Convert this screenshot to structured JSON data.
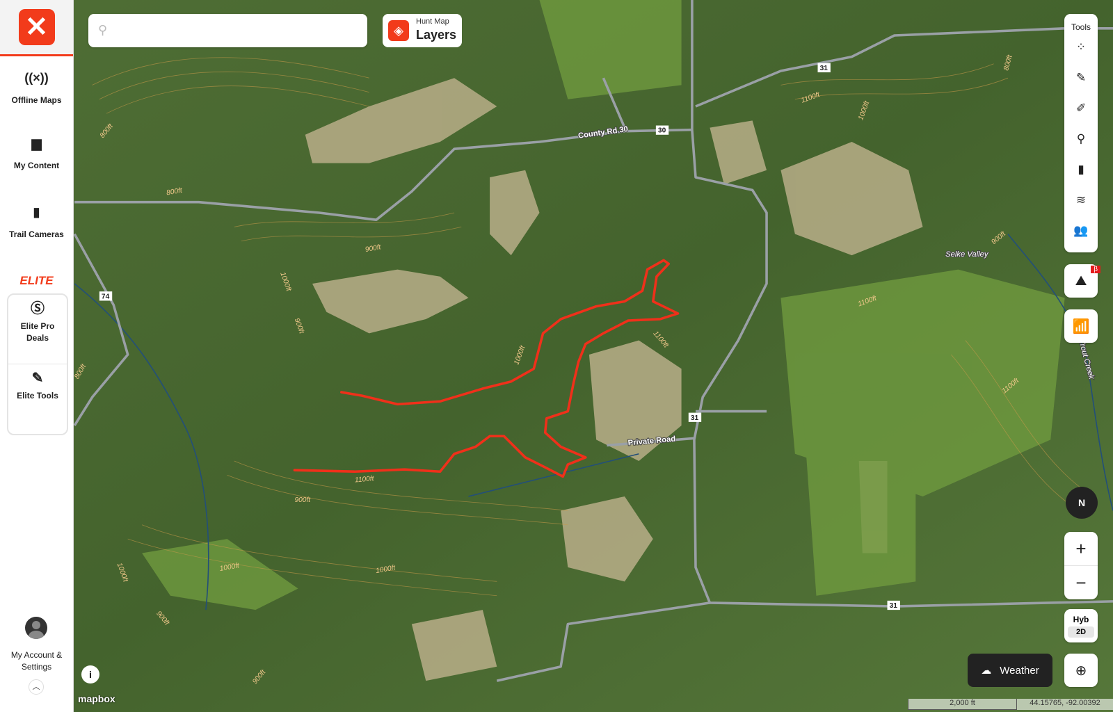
{
  "sidebar": {
    "items": [
      {
        "label": "Offline Maps",
        "icon": "offline-icon"
      },
      {
        "label": "My Content",
        "icon": "folder-icon"
      },
      {
        "label": "Trail Cameras",
        "icon": "trail-camera-icon"
      }
    ],
    "elite_heading": "ELITE",
    "elite_items": [
      {
        "label": "Elite Pro Deals",
        "icon": "dollar-icon"
      },
      {
        "label": "Elite Tools",
        "icon": "knife-icon"
      }
    ],
    "account_label": "My Account & Settings"
  },
  "search": {
    "placeholder": "",
    "value": ""
  },
  "layers": {
    "subtitle": "Hunt Map",
    "title": "Layers"
  },
  "tools": {
    "title": "Tools",
    "items": [
      "route-icon",
      "draw-line-icon",
      "draw-shape-icon",
      "waypoint-icon",
      "trail-camera-icon",
      "wind-icon",
      "group-icon"
    ],
    "beta_badge": "β"
  },
  "controls": {
    "compass": "N",
    "zoom_in": "+",
    "zoom_out": "−",
    "basemap": "Hyb",
    "view_mode": "2D",
    "weather": "Weather"
  },
  "map": {
    "attribution": "mapbox",
    "scale": "2,000 ft",
    "coordinates": "44.15765, -92.00392",
    "road_labels": [
      "County Rd 30",
      "Private Road"
    ],
    "shields": [
      "30",
      "31",
      "31",
      "31",
      "74"
    ],
    "place_labels": [
      "Selke Valley",
      "Trout Creek"
    ],
    "contour_labels": [
      "800ft",
      "800ft",
      "900ft",
      "1000ft",
      "900ft",
      "1000ft",
      "1100ft",
      "1100ft",
      "900ft",
      "1000ft",
      "1000ft",
      "1000ft",
      "900ft",
      "1100ft",
      "1000ft",
      "800ft",
      "1100ft",
      "1100ft",
      "900ft",
      "800ft",
      "900ft"
    ],
    "colors": {
      "route": "#f0301a",
      "accent": "#f23b1b"
    }
  }
}
